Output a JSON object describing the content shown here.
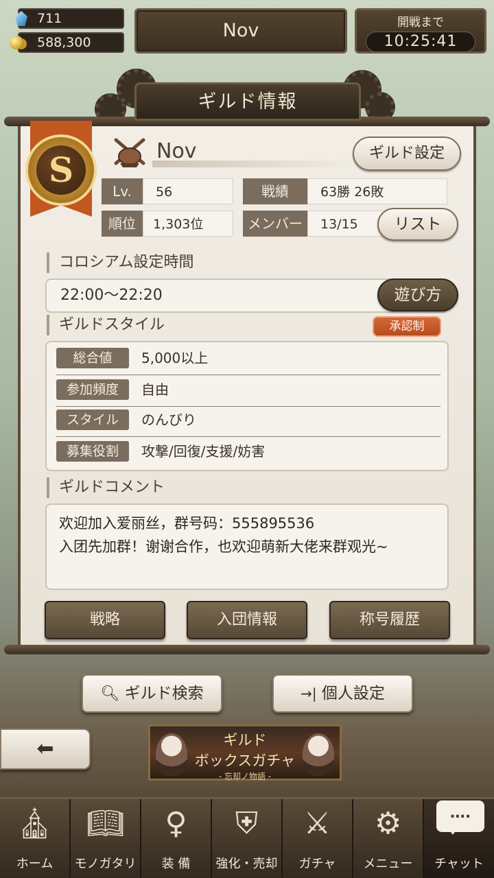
{
  "resources": {
    "crystals": "711",
    "gold": "588,300"
  },
  "guild_title_plate": "Nov",
  "battle": {
    "label": "開戦まで",
    "countdown": "10:25:41"
  },
  "panel": {
    "header": "ギルド情報",
    "rank_letter": "S",
    "guild_name": "Nov",
    "settings_button": "ギルド設定",
    "stats": {
      "level_label": "Lv.",
      "level_value": "56",
      "record_label": "戦績",
      "record_value": "63勝  26敗",
      "ranking_label": "順位",
      "ranking_value": "1,303位",
      "members_label": "メンバー",
      "members_value": "13/15",
      "list_button": "リスト"
    },
    "coliseum": {
      "title": "コロシアム設定時間",
      "time": "22:00〜22:20",
      "howto_button": "遊び方"
    },
    "style": {
      "title": "ギルドスタイル",
      "badge": "承認制",
      "rows": [
        {
          "label": "総合値",
          "value": "5,000以上"
        },
        {
          "label": "参加頻度",
          "value": "自由"
        },
        {
          "label": "スタイル",
          "value": "のんびり"
        },
        {
          "label": "募集役割",
          "value": "攻撃/回復/支援/妨害"
        }
      ]
    },
    "comment": {
      "title": "ギルドコメント",
      "lines": [
        "欢迎加入爱丽丝，群号码：555895536",
        "入团先加群！谢谢合作，也欢迎萌新大佬来群观光~"
      ]
    },
    "actions": {
      "strategy": "戦略",
      "join_info": "入団情報",
      "title_history": "称号履歴"
    }
  },
  "lower": {
    "guild_search": "ギルド検索",
    "personal_settings": "個人設定",
    "gacha_banner": {
      "line1": "ギルド",
      "line2": "ボックスガチャ",
      "sub": "- 忘却ノ物語 -"
    }
  },
  "nav": {
    "home": "ホーム",
    "story": "モノガタリ",
    "equip": "装 備",
    "enhance": "強化・売却",
    "gacha": "ガチャ",
    "menu": "メニュー",
    "chat": "チャット",
    "chat_bubble": "…."
  }
}
